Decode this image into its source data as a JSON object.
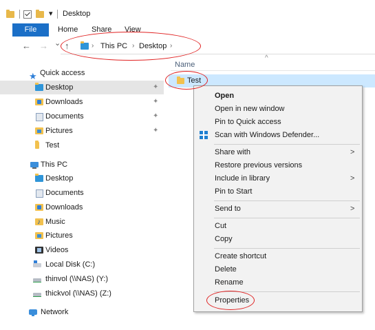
{
  "window": {
    "title": "Desktop",
    "quick_access_dropdown": "▾"
  },
  "ribbon": {
    "tabs": [
      "File",
      "Home",
      "Share",
      "View"
    ]
  },
  "address": {
    "back_icon": "←",
    "forward_icon": "→",
    "recent_icon": "⌄",
    "up_icon": "↑",
    "separator": "›",
    "crumbs": [
      "This PC",
      "Desktop"
    ]
  },
  "columns": {
    "name": "Name",
    "sort_indicator": "^"
  },
  "sidebar": {
    "quick_access": "Quick access",
    "quick_items": [
      {
        "label": "Desktop",
        "icon": "desktop-folder-icon",
        "pinned": true
      },
      {
        "label": "Downloads",
        "icon": "downloads-folder-icon",
        "pinned": true
      },
      {
        "label": "Documents",
        "icon": "documents-folder-icon",
        "pinned": true
      },
      {
        "label": "Pictures",
        "icon": "pictures-folder-icon",
        "pinned": true
      },
      {
        "label": "Test",
        "icon": "folder-icon",
        "pinned": false
      }
    ],
    "this_pc": "This PC",
    "pc_items": [
      {
        "label": "Desktop",
        "icon": "desktop-folder-icon"
      },
      {
        "label": "Documents",
        "icon": "documents-folder-icon"
      },
      {
        "label": "Downloads",
        "icon": "downloads-folder-icon"
      },
      {
        "label": "Music",
        "icon": "music-folder-icon"
      },
      {
        "label": "Pictures",
        "icon": "pictures-folder-icon"
      },
      {
        "label": "Videos",
        "icon": "videos-folder-icon"
      },
      {
        "label": "Local Disk (C:)",
        "icon": "local-disk-icon"
      },
      {
        "label": "thinvol (\\\\NAS) (Y:)",
        "icon": "network-drive-icon"
      },
      {
        "label": "thickvol (\\\\NAS) (Z:)",
        "icon": "network-drive-icon"
      }
    ],
    "network": "Network",
    "pin_glyph": "📌"
  },
  "files": [
    {
      "name": "Test"
    }
  ],
  "context_menu": {
    "arrow_glyph": ">",
    "groups": [
      [
        "Open",
        "Open in new window",
        "Pin to Quick access",
        "Scan with Windows Defender..."
      ],
      [
        "Share with",
        "Restore previous versions",
        "Include in library",
        "Pin to Start"
      ],
      [
        "Send to"
      ],
      [
        "Cut",
        "Copy"
      ],
      [
        "Create shortcut",
        "Delete",
        "Rename"
      ],
      [
        "Properties"
      ]
    ]
  },
  "colors": {
    "selection": "#cce8ff",
    "file_tab": "#1b6fc7",
    "annotation": "#e02020",
    "menu_bg": "#f2f2f2"
  }
}
